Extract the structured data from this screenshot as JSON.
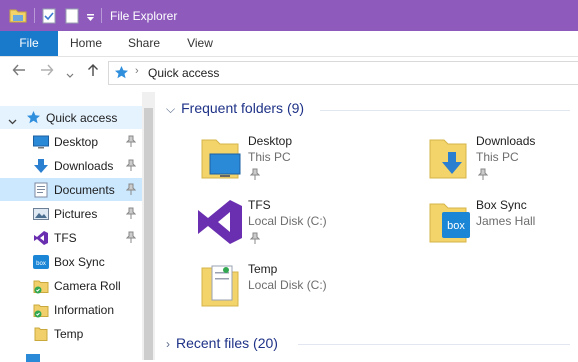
{
  "window": {
    "title": "File Explorer"
  },
  "ribbon": {
    "tabs": [
      "File",
      "Home",
      "Share",
      "View"
    ]
  },
  "address": {
    "path": "Quick access"
  },
  "sidebar": {
    "quick_access_label": "Quick access",
    "items": [
      {
        "label": "Desktop",
        "pinned": true
      },
      {
        "label": "Downloads",
        "pinned": true
      },
      {
        "label": "Documents",
        "pinned": true
      },
      {
        "label": "Pictures",
        "pinned": true
      },
      {
        "label": "TFS",
        "pinned": true
      },
      {
        "label": "Box Sync",
        "pinned": false
      },
      {
        "label": "Camera Roll",
        "pinned": false
      },
      {
        "label": "Information",
        "pinned": false
      },
      {
        "label": "Temp",
        "pinned": false
      }
    ]
  },
  "content": {
    "frequent_header": "Frequent folders (9)",
    "recent_header": "Recent files (20)",
    "folders": [
      {
        "name": "Desktop",
        "location": "This PC",
        "pinned": true
      },
      {
        "name": "Downloads",
        "location": "This PC",
        "pinned": true
      },
      {
        "name": "TFS",
        "location": "Local Disk (C:)",
        "pinned": true
      },
      {
        "name": "Box Sync",
        "location": "James Hall",
        "pinned": false
      },
      {
        "name": "Temp",
        "location": "Local Disk (C:)",
        "pinned": false
      }
    ]
  },
  "colors": {
    "titlebar": "#8e5bbd",
    "file_tab": "#1979ca",
    "header_text": "#1e3287",
    "selected": "#cce8ff"
  }
}
